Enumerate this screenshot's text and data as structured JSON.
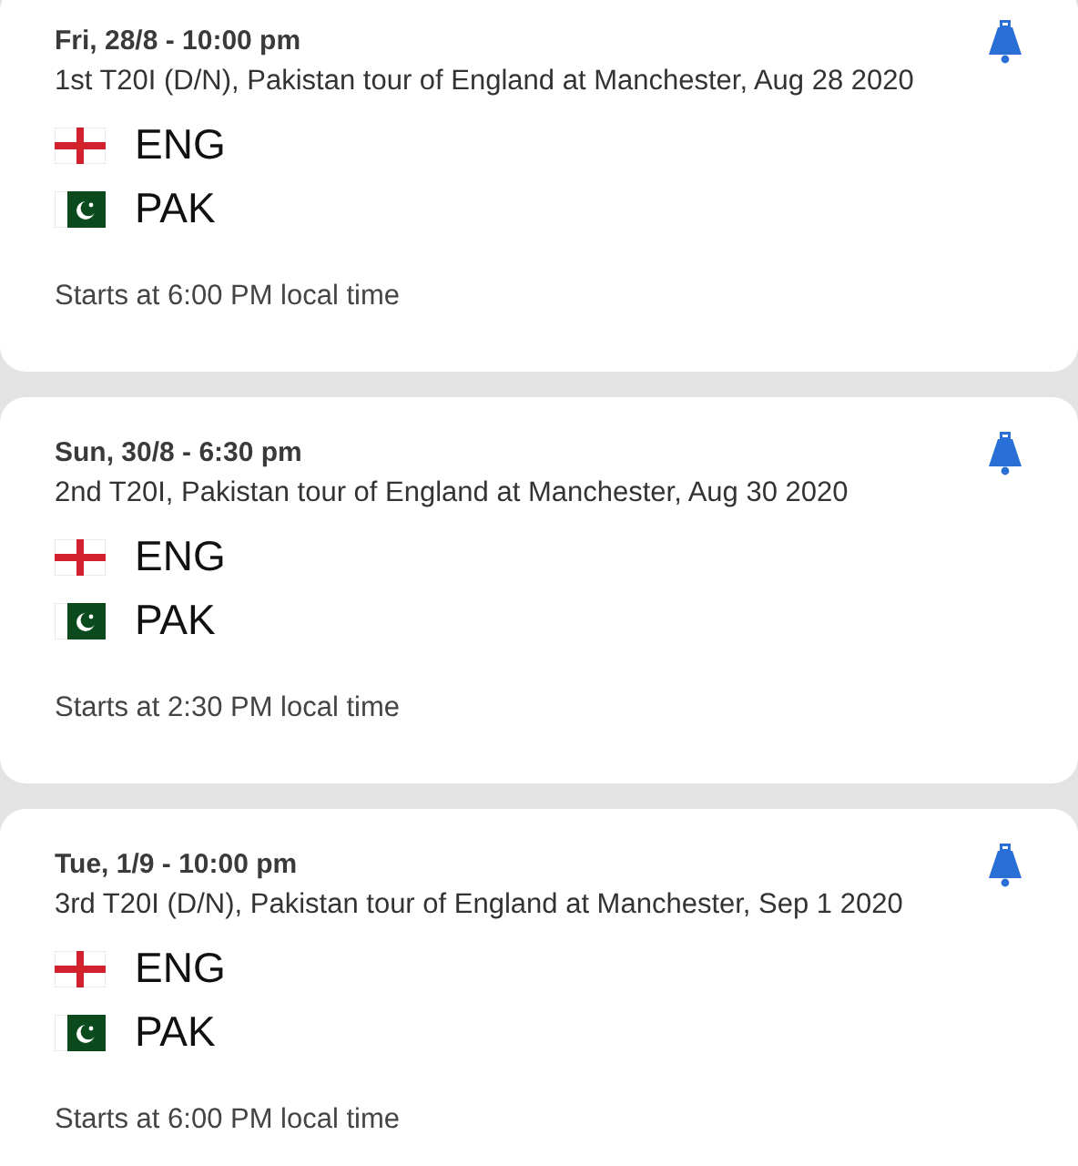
{
  "matches": [
    {
      "datetime": "Fri, 28/8 - 10:00 pm",
      "title": "1st T20I (D/N), Pakistan tour of England at Manchester, Aug 28 2020",
      "alert_on": true,
      "teams": [
        {
          "kind": "england",
          "code": "ENG"
        },
        {
          "kind": "pakistan",
          "code": "PAK"
        }
      ],
      "local_time": "Starts at 6:00 PM local time"
    },
    {
      "datetime": "Sun, 30/8 - 6:30 pm",
      "title": "2nd T20I, Pakistan tour of England at Manchester, Aug 30 2020",
      "alert_on": true,
      "teams": [
        {
          "kind": "england",
          "code": "ENG"
        },
        {
          "kind": "pakistan",
          "code": "PAK"
        }
      ],
      "local_time": "Starts at 2:30 PM local time"
    },
    {
      "datetime": "Tue, 1/9 - 10:00 pm",
      "title": "3rd T20I (D/N), Pakistan tour of England at Manchester, Sep 1 2020",
      "alert_on": true,
      "teams": [
        {
          "kind": "england",
          "code": "ENG"
        },
        {
          "kind": "pakistan",
          "code": "PAK"
        }
      ],
      "local_time": "Starts at 6:00 PM local time"
    }
  ]
}
